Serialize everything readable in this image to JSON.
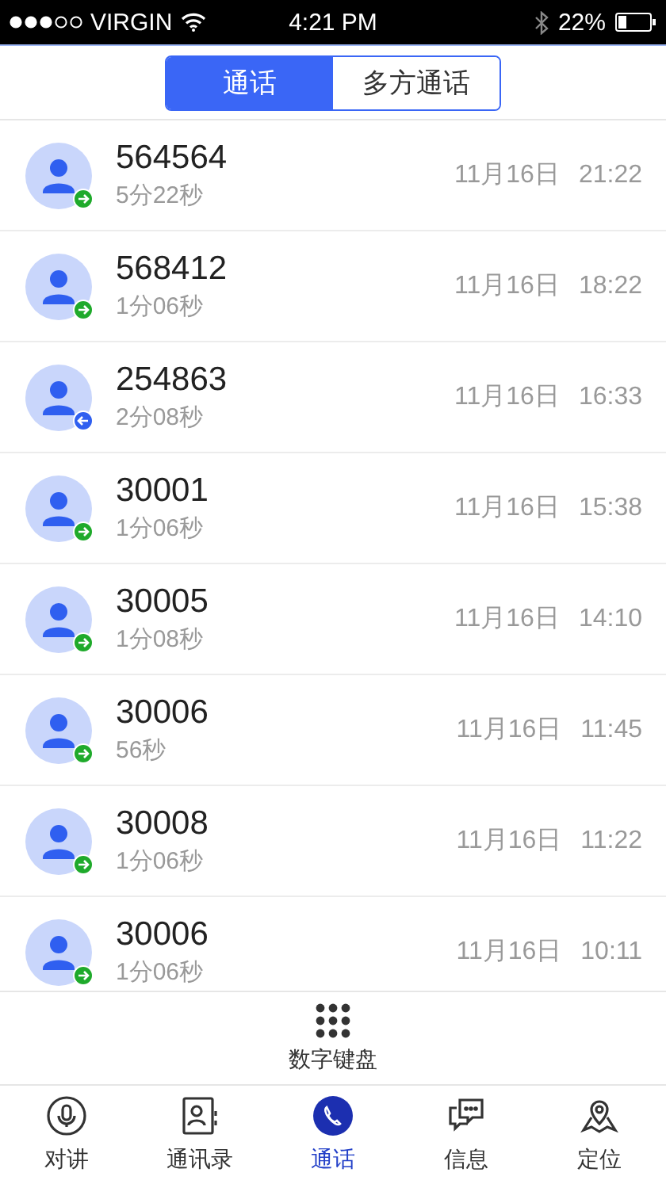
{
  "status_bar": {
    "carrier": "VIRGIN",
    "time": "4:21 PM",
    "battery": "22%"
  },
  "segments": [
    {
      "label": "通话",
      "selected": true
    },
    {
      "label": "多方通话",
      "selected": false
    }
  ],
  "calls": [
    {
      "number": "564564",
      "duration": "5分22秒",
      "date": "11月16日",
      "time": "21:22",
      "kind": "outgoing"
    },
    {
      "number": "568412",
      "duration": "1分06秒",
      "date": "11月16日",
      "time": "18:22",
      "kind": "outgoing"
    },
    {
      "number": "254863",
      "duration": "2分08秒",
      "date": "11月16日",
      "time": "16:33",
      "kind": "incoming"
    },
    {
      "number": "30001",
      "duration": "1分06秒",
      "date": "11月16日",
      "time": "15:38",
      "kind": "outgoing"
    },
    {
      "number": "30005",
      "duration": "1分08秒",
      "date": "11月16日",
      "time": "14:10",
      "kind": "outgoing"
    },
    {
      "number": "30006",
      "duration": "56秒",
      "date": "11月16日",
      "time": "11:45",
      "kind": "outgoing"
    },
    {
      "number": "30008",
      "duration": "1分06秒",
      "date": "11月16日",
      "time": "11:22",
      "kind": "outgoing"
    },
    {
      "number": "30006",
      "duration": "1分06秒",
      "date": "11月16日",
      "time": "10:11",
      "kind": "outgoing"
    }
  ],
  "keypad": {
    "label": "数字键盘"
  },
  "tab_bar": [
    {
      "label": "对讲",
      "kind": "intercom",
      "selected": false
    },
    {
      "label": "通讯录",
      "kind": "contacts",
      "selected": false
    },
    {
      "label": "通话",
      "kind": "calls",
      "selected": true
    },
    {
      "label": "信息",
      "kind": "messages",
      "selected": false
    },
    {
      "label": "定位",
      "kind": "location",
      "selected": false
    }
  ]
}
